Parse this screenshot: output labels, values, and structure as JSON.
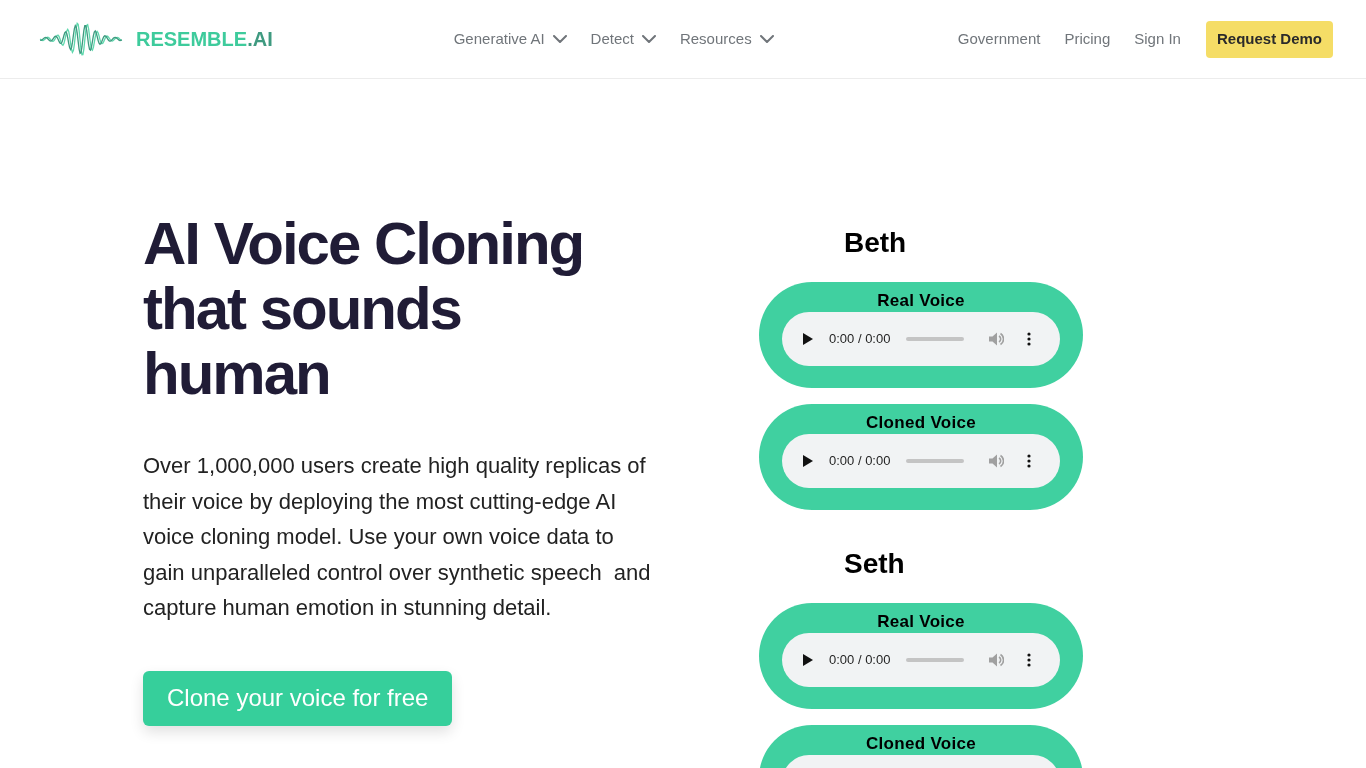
{
  "header": {
    "logo": {
      "name": "RESEMBLE",
      "suffix": ".AI"
    },
    "nav": [
      {
        "label": "Generative AI"
      },
      {
        "label": "Detect"
      },
      {
        "label": "Resources"
      }
    ],
    "links": [
      "Government",
      "Pricing",
      "Sign In"
    ],
    "cta": "Request Demo"
  },
  "hero": {
    "heading": [
      "AI Voice Cloning",
      "that sounds",
      "human"
    ],
    "description": "Over 1,000,000 users create high quality replicas of their voice by deploying the most cutting-edge AI voice cloning model. Use your own voice data to gain unparalleled control over synthetic speech  and capture human emotion in stunning detail.",
    "button": "Clone your voice for free"
  },
  "speakers": [
    {
      "name": "Beth",
      "clips": [
        {
          "label": "Real Voice",
          "time": "0:00 / 0:00"
        },
        {
          "label": "Cloned Voice",
          "time": "0:00 / 0:00"
        }
      ]
    },
    {
      "name": "Seth",
      "clips": [
        {
          "label": "Real Voice",
          "time": "0:00 / 0:00"
        },
        {
          "label": "Cloned Voice"
        }
      ]
    }
  ]
}
